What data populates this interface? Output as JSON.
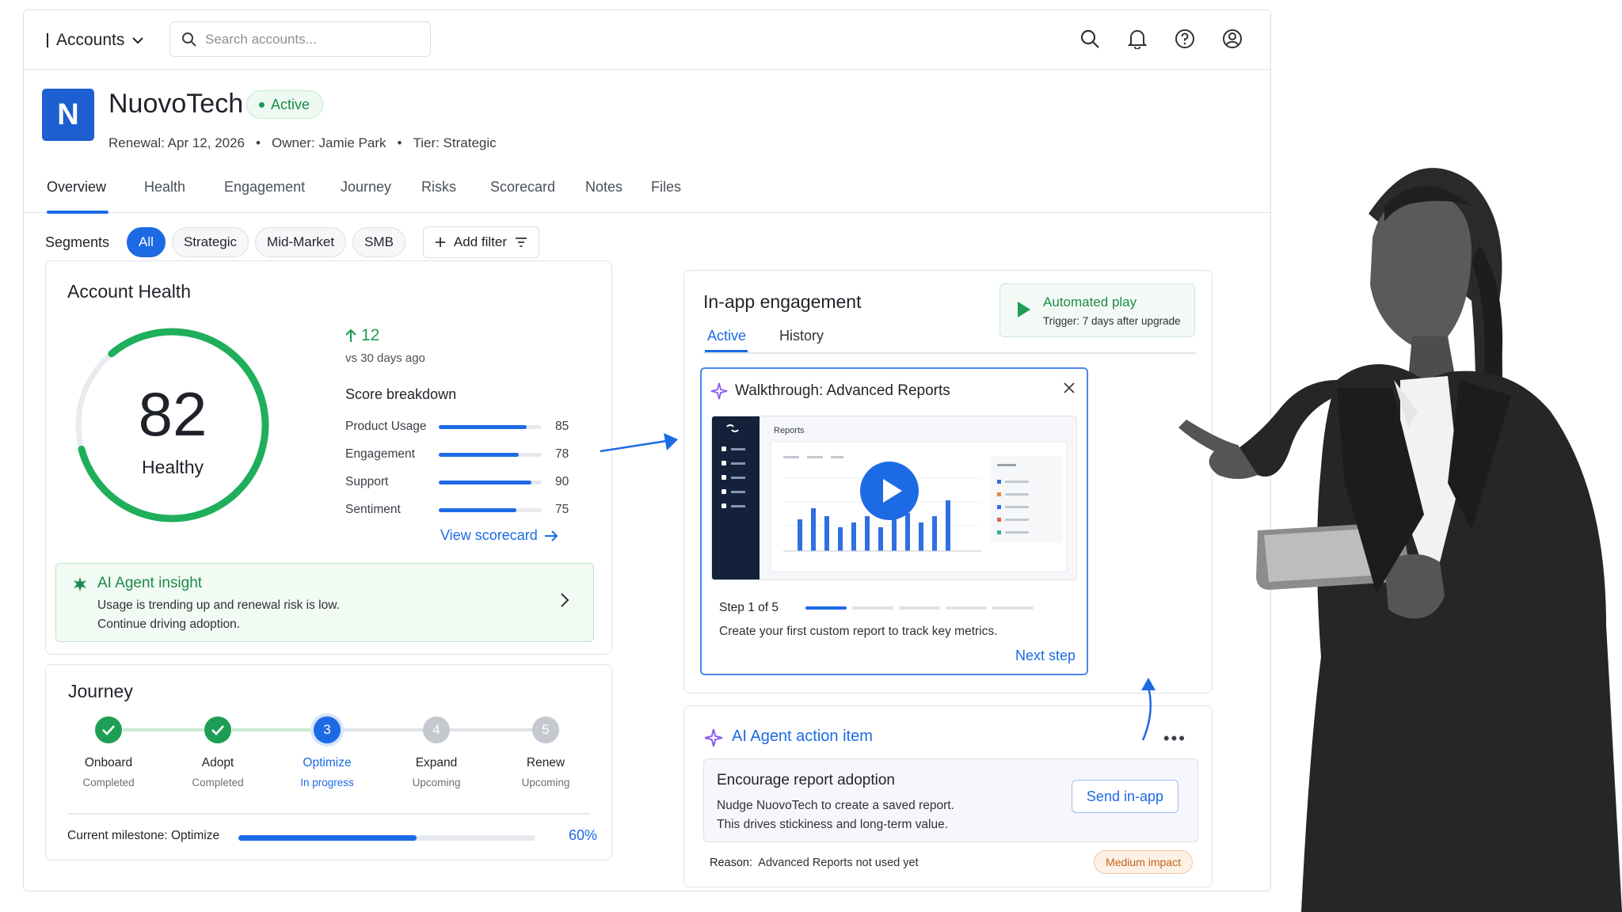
{
  "topbar": {
    "account_switcher": "Accounts",
    "search_placeholder": "Search accounts..."
  },
  "header": {
    "logo_letter": "N",
    "company": "NuovoTech",
    "status": "Active",
    "renewal": "Renewal: Apr 12, 2026",
    "owner": "Owner: Jamie Park",
    "tier": "Tier: Strategic",
    "separator": "•"
  },
  "tabs": [
    "Overview",
    "Health",
    "Engagement",
    "Journey",
    "Risks",
    "Scorecard",
    "Notes",
    "Files"
  ],
  "segments": {
    "label": "Segments",
    "chips": [
      "All",
      "Strategic",
      "Mid-Market",
      "SMB"
    ],
    "selected": "All",
    "add_filter": "Add filter"
  },
  "account_health": {
    "title": "Account Health",
    "score": "82",
    "score_value": 82,
    "status": "Healthy",
    "delta": "12",
    "delta_caption": "vs 30 days ago",
    "breakdown_title": "Score breakdown",
    "breakdown": [
      {
        "label": "Product Usage",
        "value": "85",
        "score": 85
      },
      {
        "label": "Engagement",
        "value": "78",
        "score": 78
      },
      {
        "label": "Support",
        "value": "90",
        "score": 90
      },
      {
        "label": "Sentiment",
        "value": "75",
        "score": 75
      }
    ],
    "view_scorecard": "View scorecard",
    "insight": {
      "title": "AI Agent insight",
      "line1": "Usage is trending up and renewal risk is low.",
      "line2": "Continue driving adoption."
    }
  },
  "journey": {
    "title": "Journey",
    "stages": [
      {
        "name": "Onboard",
        "status": "Completed",
        "number": "1"
      },
      {
        "name": "Adopt",
        "status": "Completed",
        "number": "2"
      },
      {
        "name": "Optimize",
        "status": "In progress",
        "number": "3"
      },
      {
        "name": "Expand",
        "status": "Upcoming",
        "number": "4"
      },
      {
        "name": "Renew",
        "status": "Upcoming",
        "number": "5"
      }
    ],
    "milestone_label": "Current milestone: Optimize",
    "milestone_progress": "60%",
    "milestone_fraction": 0.6
  },
  "engagement": {
    "title": "In-app engagement",
    "tabs": [
      "Active",
      "History"
    ],
    "automated_play": {
      "title": "Automated play",
      "trigger": "Trigger: 7 days after upgrade"
    },
    "walkthrough": {
      "title": "Walkthrough: Advanced Reports",
      "video_label": "Reports",
      "step": "Step 1 of 5",
      "steps_total": 5,
      "step_current": 1,
      "description": "Create your first custom report to track key metrics.",
      "next": "Next step"
    }
  },
  "action_item": {
    "title": "AI Agent action item",
    "more": "•••",
    "heading": "Encourage report adoption",
    "line1": "Nudge NuovoTech to create a saved report.",
    "line2": "This drives stickiness and long-term value.",
    "button": "Send in-app",
    "reason_label": "Reason:",
    "reason": "Advanced Reports not used yet",
    "impact": "Medium impact"
  },
  "colors": {
    "accent": "#1d6ae5",
    "success": "#1e9e55",
    "warning": "#c2621a",
    "logo": "#1d5fd1"
  }
}
